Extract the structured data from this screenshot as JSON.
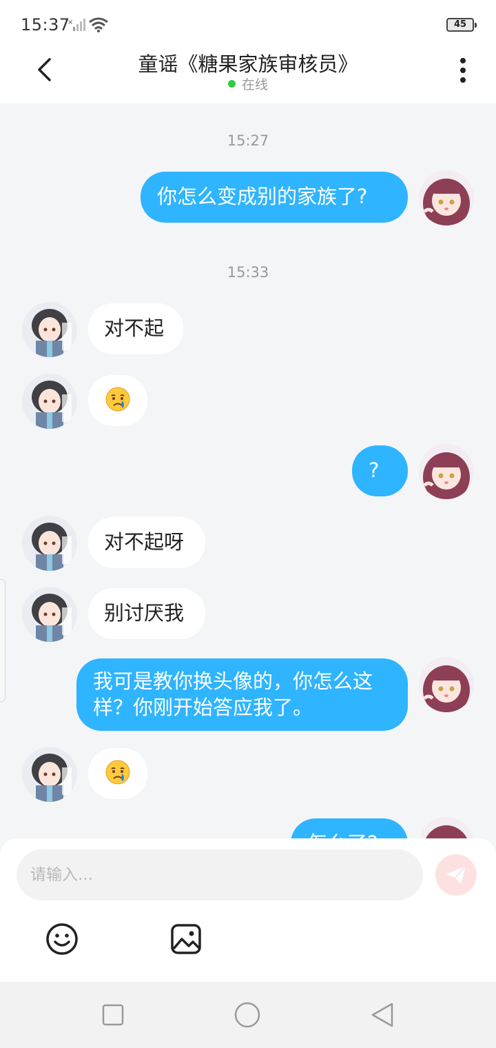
{
  "status_bar": {
    "time": "15:37",
    "battery": "45"
  },
  "header": {
    "title": "童谣《糖果家族审核员》",
    "status": "在线"
  },
  "messages": [
    {
      "type": "timestamp",
      "text": "15:27"
    },
    {
      "type": "outgoing",
      "text": "你怎么变成别的家族了?"
    },
    {
      "type": "timestamp",
      "text": "15:33"
    },
    {
      "type": "incoming",
      "text": "对不起"
    },
    {
      "type": "incoming",
      "text": "😢",
      "emoji": "crying-face"
    },
    {
      "type": "outgoing",
      "text": "?"
    },
    {
      "type": "incoming",
      "text": "对不起呀"
    },
    {
      "type": "incoming",
      "text": "别讨厌我"
    },
    {
      "type": "outgoing",
      "text": "我可是教你换头像的，你怎么这样？你刚开始答应我了。"
    },
    {
      "type": "incoming",
      "text": "😢",
      "emoji": "crying-face"
    },
    {
      "type": "outgoing",
      "text": "怎么了?"
    }
  ],
  "composer": {
    "placeholder": "请输入..."
  },
  "icons": {
    "back": "back-arrow-icon",
    "more": "more-vertical-icon",
    "send": "send-icon",
    "emoji": "emoji-icon",
    "image": "image-icon"
  },
  "colors": {
    "outgoing_bubble": "#2fb4ff",
    "incoming_bubble": "#ffffff",
    "background": "#f4f5f7",
    "online": "#2ecc40",
    "send_button": "#fde1e1"
  }
}
